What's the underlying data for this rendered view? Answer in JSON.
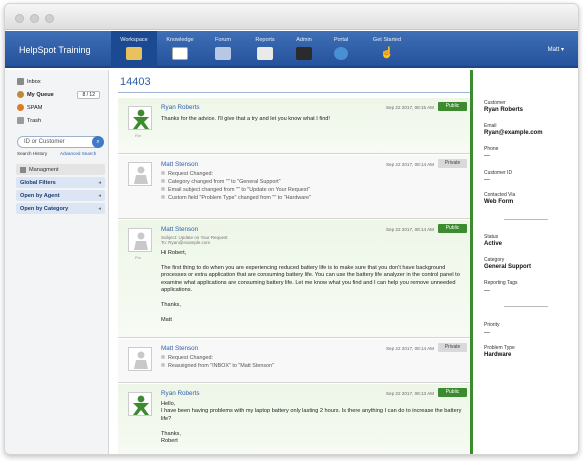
{
  "app": {
    "title": "HelpSpot Training",
    "user_menu": "Matt ▾"
  },
  "nav": [
    {
      "label": "Workspace",
      "icon": "workspace-icon",
      "active": true
    },
    {
      "label": "Knowledge",
      "icon": "knowledge-icon"
    },
    {
      "label": "Forum",
      "icon": "forum-icon"
    },
    {
      "label": "Reports",
      "icon": "reports-icon"
    },
    {
      "label": "Admin",
      "icon": "admin-icon"
    },
    {
      "label": "Portal",
      "icon": "portal-icon"
    },
    {
      "label": "Get Started",
      "icon": "pointer-icon"
    }
  ],
  "sidebar": {
    "inbox": "Inbox",
    "queue": "My Queue",
    "queue_count": "8 / 12",
    "spam": "SPAM",
    "trash": "Trash",
    "search_placeholder": "ID or Customer",
    "search_history": "Search History",
    "advanced_search": "Advanced Search",
    "managment": "Managment",
    "global_filters": "Global Filters",
    "open_by_agent": "Open by Agent",
    "open_by_category": "Open by Category"
  },
  "request": {
    "id": "14403",
    "notes": [
      {
        "name": "Ryan Roberts",
        "date": "Sep 22 2017, 08:15 AM",
        "badge": "Public",
        "avatar_label": "Rin",
        "text": "Thanks for the advice. I'll give that a try and let you know what I find!"
      },
      {
        "name": "Matt Stenson",
        "date": "Sep 22 2017, 08:14 AM",
        "badge": "Private",
        "log": [
          "Request Changed:",
          "Category changed from \"\" to \"General Support\"",
          "Email subject changed from \"\" to \"Update on Your Request\"",
          "Custom field \"Problem Type\" changed from \"\" to \"Hardware\""
        ]
      },
      {
        "name": "Matt Stenson",
        "date": "Sep 22 2017, 08:14 AM",
        "badge": "Public",
        "avatar_label": "Pro",
        "subject": "Subject: Update on Your Request",
        "to": "To: Ryan@example.com",
        "text": "Hi Robert,\n\nThe first thing to do when you are experiencing reduced battery life is to make sure that you don't have background processes or extra application that are consuming battery life. You can use the battery life analyzer in the control panel to examine what applications are consuming battery life. Let me know what you find and I can help you remove unneeded applications.\n\nThanks,\n\nMatt"
      },
      {
        "name": "Matt Stenson",
        "date": "Sep 22 2017, 08:14 AM",
        "badge": "Private",
        "log": [
          "Request Changed:",
          "Reassigned from \"INBOX\" to \"Matt Stenson\""
        ]
      },
      {
        "name": "Ryan Roberts",
        "date": "Sep 22 2017, 08:13 AM",
        "badge": "Public",
        "text": "Hello,\nI have been having problems with my laptop battery only lasting 2 hours. Is there anything I can do to increase the battery life?\n\nThanks,\nRobert"
      }
    ]
  },
  "details": {
    "customer_label": "Customer",
    "customer": "Ryan Roberts",
    "email_label": "Email",
    "email": "Ryan@example.com",
    "phone_label": "Phone",
    "phone": "—",
    "customer_id_label": "Customer ID",
    "customer_id": "—",
    "contacted_via_label": "Contacted Via",
    "contacted_via": "Web Form",
    "status_label": "Status",
    "status": "Active",
    "category_label": "Category",
    "category": "General Support",
    "tags_label": "Reporting Tags",
    "tags": "—",
    "priority_label": "Priority",
    "priority": "—",
    "problem_type_label": "Problem Type",
    "problem_type": "Hardware"
  },
  "colors": {
    "accent": "#2e5fa7",
    "public": "#3d8b2f",
    "nav": "#2a5aa3"
  }
}
